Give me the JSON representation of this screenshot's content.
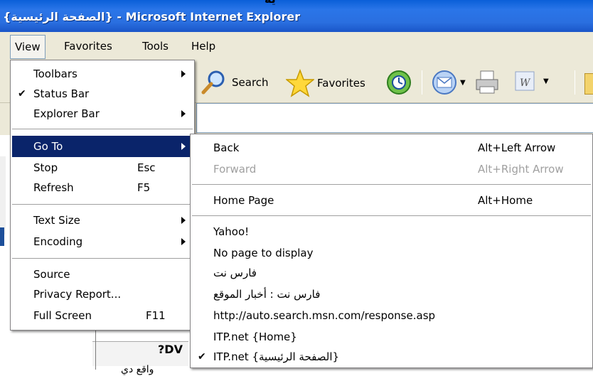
{
  "window": {
    "title": "{الصفحة الرئيسية} - Microsoft Internet Explorer",
    "top_clip_text": "ية"
  },
  "menubar": {
    "items": [
      "View",
      "Favorites",
      "Tools",
      "Help"
    ]
  },
  "toolbar": {
    "search_label": "Search",
    "favorites_label": "Favorites"
  },
  "view_menu": {
    "items": [
      {
        "label": "Toolbars",
        "submenu": true
      },
      {
        "label": "Status Bar",
        "checked": true
      },
      {
        "label": "Explorer Bar",
        "submenu": true
      },
      {
        "label": "Go To",
        "submenu": true,
        "highlighted": true
      },
      {
        "label": "Stop",
        "shortcut": "Esc"
      },
      {
        "label": "Refresh",
        "shortcut": "F5"
      },
      {
        "label": "Text Size",
        "submenu": true
      },
      {
        "label": "Encoding",
        "submenu": true
      },
      {
        "label": "Source"
      },
      {
        "label": "Privacy Report..."
      },
      {
        "label": "Full Screen",
        "shortcut": "F11"
      }
    ]
  },
  "goto_menu": {
    "items": [
      {
        "label": "Back",
        "shortcut": "Alt+Left Arrow"
      },
      {
        "label": "Forward",
        "shortcut": "Alt+Right Arrow",
        "disabled": true
      },
      {
        "label": "Home Page",
        "shortcut": "Alt+Home"
      },
      {
        "label": "Yahoo!"
      },
      {
        "label": "No page to display"
      },
      {
        "label": "فارس نت"
      },
      {
        "label": "فارس نت : أخبار الموقع"
      },
      {
        "label": "http://auto.search.msn.com/response.asp"
      },
      {
        "label": "ITP.net {Home}"
      },
      {
        "label": "ITP.net {الصفحة الرئيسية}",
        "checked": true
      }
    ]
  },
  "page_fragments": {
    "frag1": "?DV",
    "frag2": "واقع دي"
  },
  "colors": {
    "titlebar": "#2a6fe0",
    "menu_highlight": "#0a246a",
    "chrome": "#ece9d8"
  }
}
